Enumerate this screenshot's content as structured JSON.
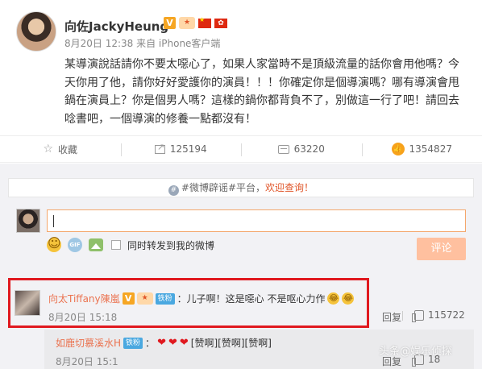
{
  "post": {
    "author": "向佐JackyHeung",
    "verified_mark": "V",
    "timestamp": "8月20日 12:38 来自 iPhone客户端",
    "text": "某導演說話請你不要太噁心了，如果人家當時不是頂級流量的話你會用他嗎？今天你用了他，請你好好愛護你的演員！！！你確定你是個導演嗎？哪有導演會甩鍋在演員上？你是個男人嗎？這樣的鍋你都背負不了，別做這一行了吧！請回去唸書吧，一個導演的修養一點都沒有！"
  },
  "actions": {
    "favorite_label": "收藏",
    "repost_count": "125194",
    "comment_count": "63220",
    "like_count": "1354827"
  },
  "notice": {
    "prefix": "#微博辟谣#平台，",
    "emphasis": "欢迎查询！"
  },
  "composer": {
    "sync_label": "同时转发到我的微博",
    "submit_label": "评论",
    "gif_label": "GIF"
  },
  "comment": {
    "author": "向太Tiffany陳嵐",
    "verified_mark": "V",
    "fan_badge": "铁粉",
    "text": "：儿子啊！这是噁心 不是呕心力作",
    "time": "8月20日 15:18",
    "reply_label": "回复",
    "like_count": "115722"
  },
  "sub_reply": {
    "author": "如鹿切慕溪水H",
    "fan_badge": "铁粉",
    "text": "[赞啊][赞啊][赞啊]",
    "time": "8月20日 15:1",
    "reply_label": "回复",
    "like_count": "18"
  },
  "watermark": "头条@娱乐侦探",
  "colors": {
    "accent_orange": "#eb7350",
    "highlight_red": "#e0191f",
    "submit_bg": "#ffc09f"
  }
}
